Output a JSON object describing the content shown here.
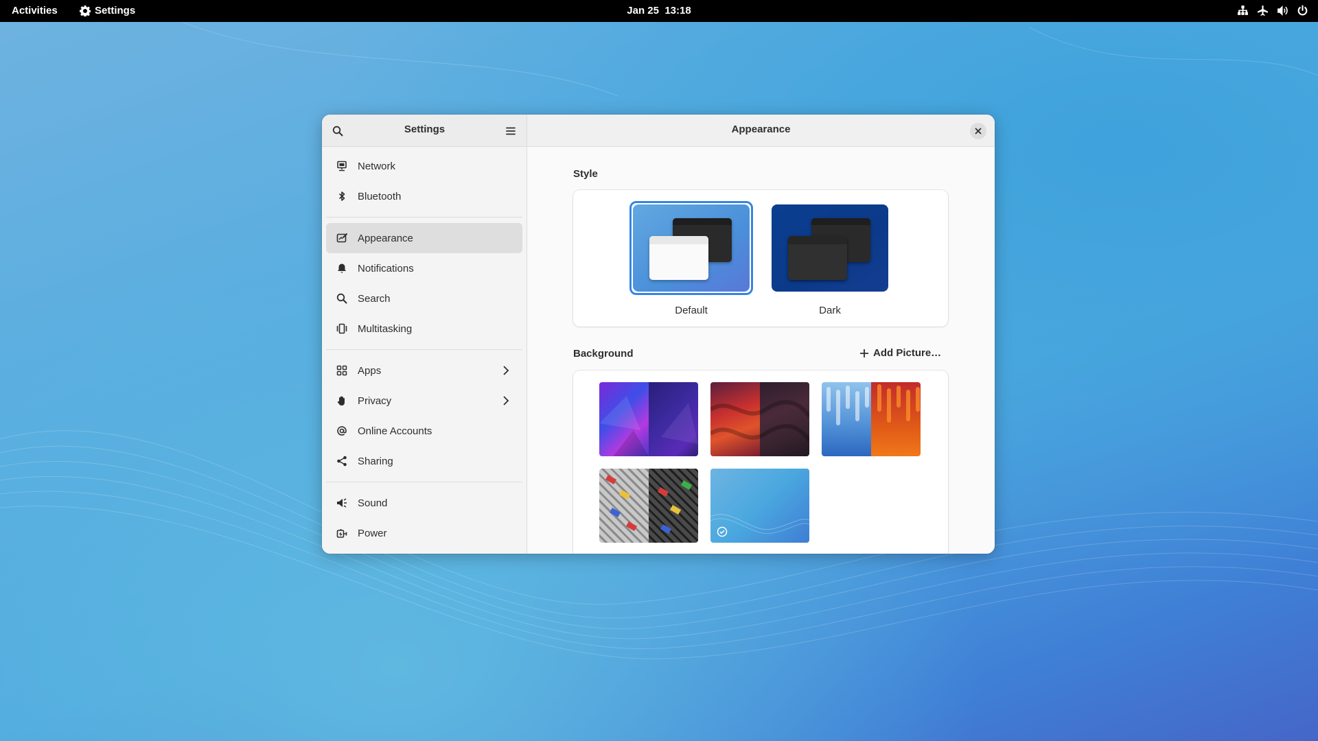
{
  "topbar": {
    "activities": "Activities",
    "app_name": "Settings",
    "date": "Jan 25",
    "time": "13:18",
    "tray_icons": [
      "network-wired-icon",
      "airplane-mode-icon",
      "volume-icon",
      "power-icon"
    ]
  },
  "sidebar": {
    "title": "Settings",
    "items": [
      {
        "label": "Network",
        "icon": "network-icon"
      },
      {
        "label": "Bluetooth",
        "icon": "bluetooth-icon"
      },
      {
        "label": "Appearance",
        "icon": "appearance-icon",
        "active": true
      },
      {
        "label": "Notifications",
        "icon": "bell-icon"
      },
      {
        "label": "Search",
        "icon": "search-icon"
      },
      {
        "label": "Multitasking",
        "icon": "multitasking-icon"
      },
      {
        "label": "Apps",
        "icon": "apps-icon",
        "has_submenu": true
      },
      {
        "label": "Privacy",
        "icon": "hand-icon",
        "has_submenu": true
      },
      {
        "label": "Online Accounts",
        "icon": "at-icon"
      },
      {
        "label": "Sharing",
        "icon": "share-icon"
      },
      {
        "label": "Sound",
        "icon": "speaker-icon"
      },
      {
        "label": "Power",
        "icon": "power-plug-icon"
      }
    ]
  },
  "content": {
    "title": "Appearance",
    "style": {
      "label": "Style",
      "options": [
        {
          "label": "Default",
          "selected": true
        },
        {
          "label": "Dark",
          "selected": false
        }
      ]
    },
    "background": {
      "label": "Background",
      "add_label": "Add Picture…",
      "wallpapers": [
        {
          "name": "blue-purple-triangles",
          "selected": false
        },
        {
          "name": "red-waves",
          "selected": false
        },
        {
          "name": "drips-blue-orange",
          "selected": false
        },
        {
          "name": "tiles-grey",
          "selected": false
        },
        {
          "name": "fedora-blue",
          "selected": true
        }
      ]
    }
  },
  "colors": {
    "accent": "#3584e4",
    "sidebar_active": "#dedede",
    "topbar": "#000000"
  }
}
